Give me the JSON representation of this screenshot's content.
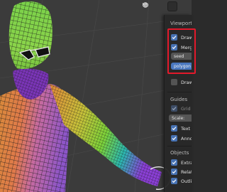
{
  "panel": {
    "viewport_section": "Viewport",
    "draw_label": "Draw",
    "merge_label": "Merge",
    "seed_value": "seed",
    "polygon_value": "polygon",
    "draw_label_2": "Draw",
    "guides_section": "Guides",
    "grid_label": "Grid",
    "scale_label": "Scale:",
    "text_info_label": "Text I",
    "annotations_label": "Annot",
    "objects_section": "Objects",
    "extras_label": "Extra",
    "relations_label": "Relati",
    "outline_label": "Outlin"
  },
  "colors": {
    "accent": "#4772b3",
    "highlight_box": "#e3192b",
    "panel_bg": "#282828",
    "viewport_bg": "#3b3b3b"
  },
  "icons": [
    "mesh-mode-icon",
    "overlay-dropdown-icon",
    "chevron-down-icon",
    "checkbox-check-icon"
  ]
}
